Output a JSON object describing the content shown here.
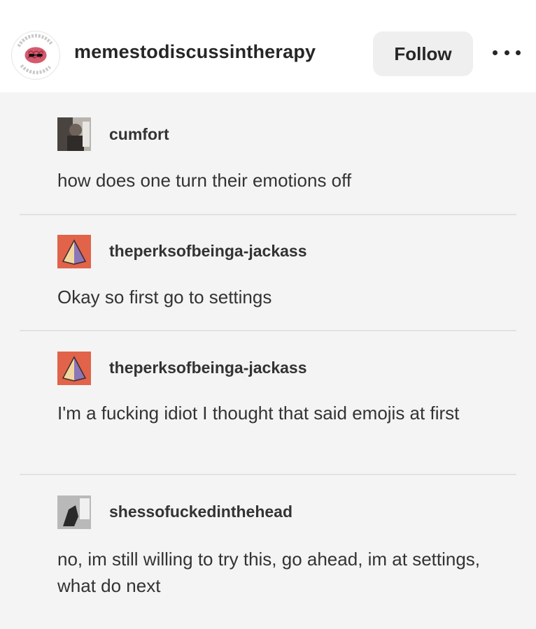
{
  "header": {
    "username": "memestodiscussintherapy",
    "follow_label": "Follow",
    "avatar_icon": "brain-with-sunglasses-logo"
  },
  "post": {
    "entries": [
      {
        "user": "cumfort",
        "text": "how does one turn their emotions off",
        "icon": "photo-avatar"
      },
      {
        "user": "theperksofbeinga-jackass",
        "text": "Okay so first go to settings",
        "icon": "pyramid-avatar"
      },
      {
        "user": "theperksofbeinga-jackass",
        "text": "I'm a fucking idiot I thought that said emojis at first",
        "icon": "pyramid-avatar"
      },
      {
        "user": "shessofuckedinthehead",
        "text": " no, im still willing to try this, go ahead, im at settings, what do next",
        "icon": "photo-avatar"
      }
    ]
  }
}
